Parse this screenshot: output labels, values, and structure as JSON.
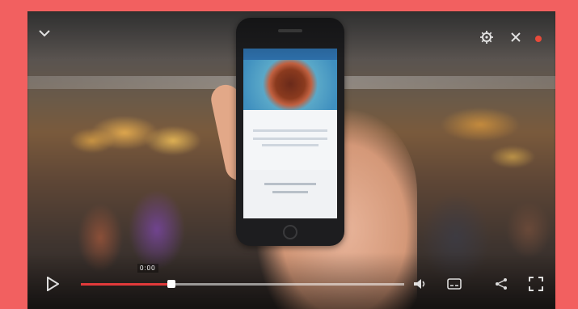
{
  "player": {
    "time_label": "0:00",
    "progress": 0.28,
    "accent_color": "#e23a3a",
    "frame_color": "#f26060"
  },
  "icons": {
    "top_left": "chevron-down-icon",
    "top_right_settings": "gear-icon",
    "top_right_close": "close-icon",
    "bottom_left": "play-icon",
    "bottom_right": [
      "volume-icon",
      "captions-icon",
      "share-icon",
      "fullscreen-icon"
    ]
  }
}
